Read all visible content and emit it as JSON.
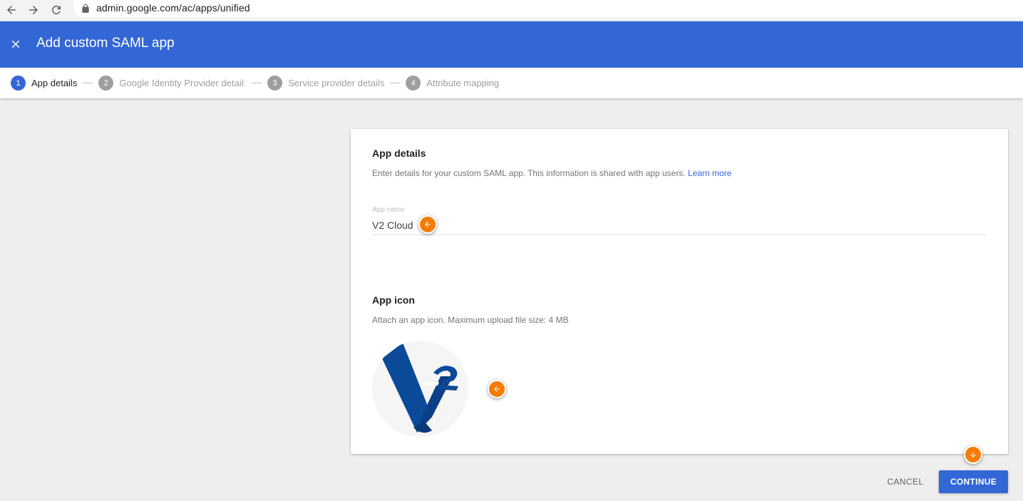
{
  "browser": {
    "url": "admin.google.com/ac/apps/unified"
  },
  "header": {
    "title": "Add custom SAML app",
    "close_icon": "close-icon"
  },
  "stepper": {
    "steps": [
      {
        "number": "1",
        "label": "App details"
      },
      {
        "number": "2",
        "label": "Google Identity Provider detail:"
      },
      {
        "number": "3",
        "label": "Service provider details"
      },
      {
        "number": "4",
        "label": "Attribute mapping"
      }
    ]
  },
  "app_details": {
    "title": "App details",
    "description": "Enter details for your custom SAML app. This information is shared with app users.",
    "learn_more": "Learn more",
    "app_name_label": "App name",
    "app_name_value": "V2 Cloud"
  },
  "app_icon": {
    "title": "App icon",
    "description": "Attach an app icon. Maximum upload file size: 4 MB",
    "logo_text": "V2"
  },
  "actions": {
    "cancel": "CANCEL",
    "continue": "CONTINUE"
  },
  "colors": {
    "header": "#3367d6",
    "accent": "#3367d6",
    "marker": "#f57c00",
    "logo_blue": "#0b4a99"
  }
}
